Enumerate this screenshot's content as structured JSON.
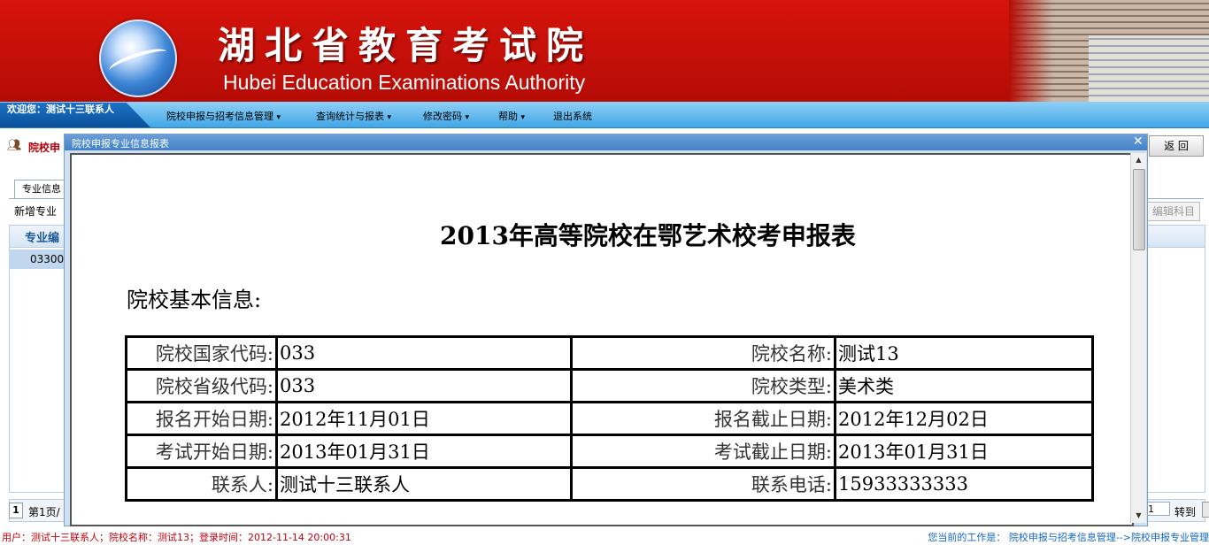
{
  "banner": {
    "title": "湖北省教育考试院",
    "subtitle": "Hubei Education Examinations Authority"
  },
  "menubar": {
    "welcome": "欢迎您：测试十三联系人",
    "items": [
      {
        "label": "院校申报与招考信息管理"
      },
      {
        "label": "查询统计与报表"
      },
      {
        "label": "修改密码"
      },
      {
        "label": "帮助"
      },
      {
        "label": "退出系统"
      }
    ]
  },
  "page": {
    "title": "院校申",
    "back_label": "返 回",
    "tab_label": "专业信息",
    "add_major_label": "新增专业",
    "edit_subject_label": "编辑科目",
    "column_major_code": "专业编",
    "row1_code": "03300",
    "pager_page": "1",
    "pager_info": "第1页/",
    "goto_value": "1",
    "goto_label": "转到"
  },
  "modal": {
    "title": "院校申报专业信息报表",
    "report_title": "2013年高等院校在鄂艺术校考申报表",
    "section_heading": "院校基本信息:",
    "rows": [
      {
        "label1": "院校国家代码:",
        "value1": "033",
        "label2": "院校名称:",
        "value2": "测试13"
      },
      {
        "label1": "院校省级代码:",
        "value1": "033",
        "label2": "院校类型:",
        "value2": "美术类"
      },
      {
        "label1": "报名开始日期:",
        "value1": "2012年11月01日",
        "label2": "报名截止日期:",
        "value2": "2012年12月02日"
      },
      {
        "label1": "考试开始日期:",
        "value1": "2013年01月31日",
        "label2": "考试截止日期:",
        "value2": "2013年01月31日"
      },
      {
        "label1": "联系人:",
        "value1": "测试十三联系人",
        "label2": "联系电话:",
        "value2": "15933333333"
      }
    ]
  },
  "statusbar": {
    "left": "用户：测试十三联系人；院校名称：测试13；登录时间：2012-11-14 20:00:31",
    "right_label": "您当前的工作是：",
    "right_path": "院校申报与招考信息管理-->院校申报专业管理"
  },
  "colors": {
    "banner_red": "#c8100a",
    "menubar_blue": "#5bb4ec",
    "accent_red": "#b3000b",
    "link_blue": "#1266c4"
  }
}
